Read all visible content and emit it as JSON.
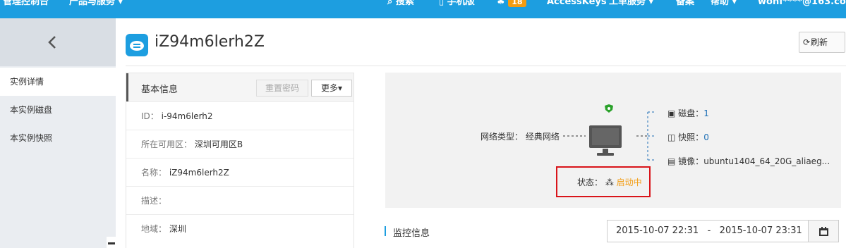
{
  "topbar": {
    "console": "管理控制台",
    "products": "产品与服务",
    "search": "搜索",
    "mobile": "手机版",
    "notifications": "18",
    "accesskeys": "AccessKeys",
    "tickets": "工单服务",
    "beian": "备案",
    "help": "帮助",
    "user": "wonf****@163.co"
  },
  "sidebar": {
    "items": [
      {
        "label": "实例详情"
      },
      {
        "label": "本实例磁盘"
      },
      {
        "label": "本实例快照"
      }
    ]
  },
  "header": {
    "title": "iZ94m6lerh2Z",
    "refresh_label": "刷新"
  },
  "basic_info": {
    "title": "基本信息",
    "reset_password": "重置密码",
    "more": "更多",
    "rows": [
      {
        "label": "ID：",
        "value": "i-94m6lerh2"
      },
      {
        "label": "所在可用区：",
        "value": "深圳可用区B"
      },
      {
        "label": "名称：",
        "value": "iZ94m6lerh2Z"
      },
      {
        "label": "描述：",
        "value": ""
      },
      {
        "label": "地域：",
        "value": "深圳"
      }
    ]
  },
  "diagram": {
    "network_label": "网络类型：",
    "network_value": "经典网络",
    "disk_label": "磁盘：",
    "disk_value": "1",
    "snapshot_label": "快照：",
    "snapshot_value": "0",
    "image_label": "镜像：",
    "image_value": "ubuntu1404_64_20G_aliaeg...",
    "status_label": "状态：",
    "status_value": "启动中"
  },
  "monitor": {
    "title": "监控信息",
    "date_start": "2015-10-07 22:31",
    "date_sep": "-",
    "date_end": "2015-10-07 23:31"
  },
  "colors": {
    "topbar": "#1d9ee0",
    "status": "#f39c12",
    "highlight": "#d9141a"
  },
  "icons": [
    "chevron-left-icon",
    "cloud-server-icon",
    "refresh-icon",
    "shield-icon",
    "monitor-icon",
    "disk-icon",
    "snapshot-icon",
    "image-icon",
    "spinner-icon",
    "calendar-icon",
    "search-icon",
    "mobile-icon",
    "bell-icon"
  ]
}
